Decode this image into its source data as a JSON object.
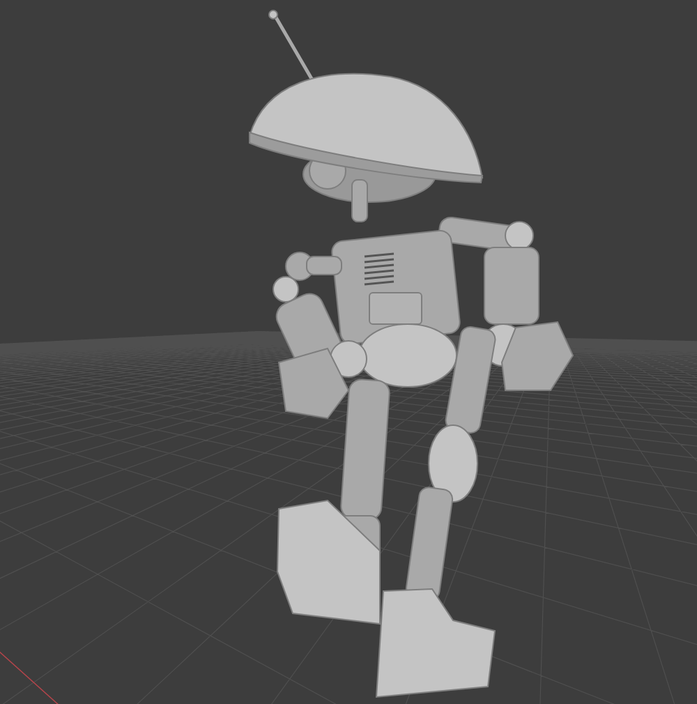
{
  "viewport": {
    "show_floor_grid": true,
    "show_x_axis": true
  }
}
